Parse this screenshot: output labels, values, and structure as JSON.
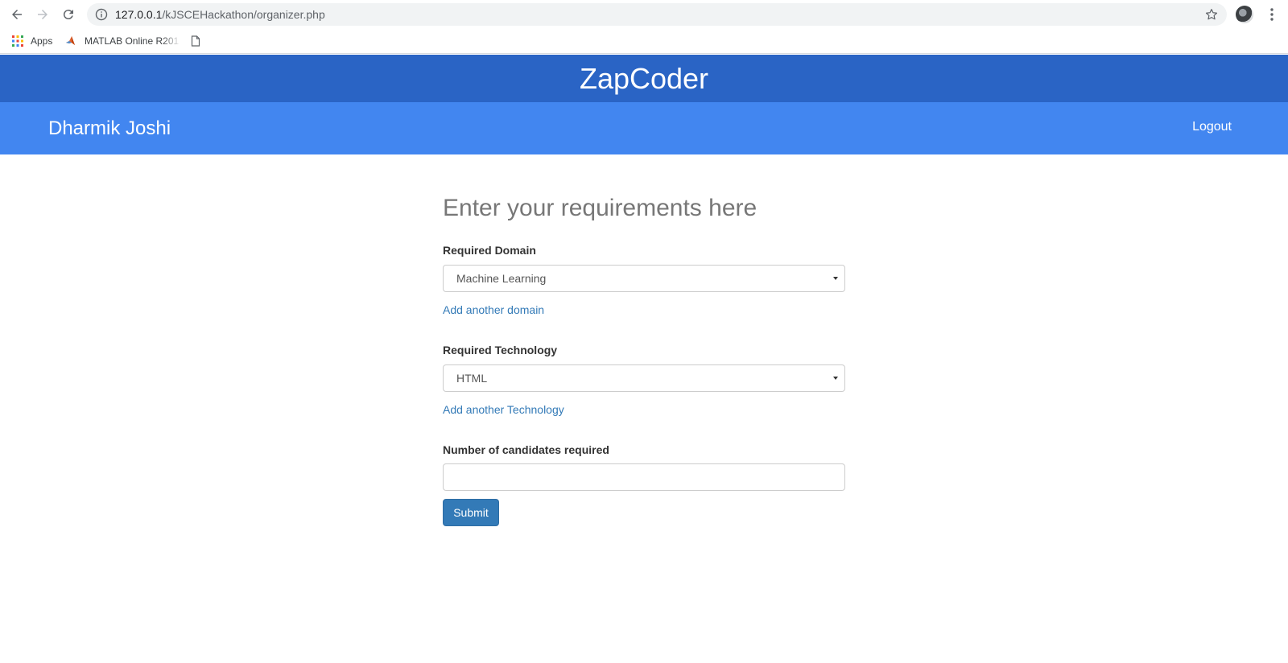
{
  "browser": {
    "url_host": "127.0.0.1",
    "url_path": "/kJSCEHackathon/organizer.php",
    "bookmarks": [
      {
        "label": "Apps",
        "icon": "apps-grid-icon"
      },
      {
        "label": "MATLAB Online R201",
        "icon": "matlab-icon"
      },
      {
        "label": "",
        "icon": "page-icon"
      }
    ]
  },
  "header": {
    "brand": "ZapCoder",
    "user_name": "Dharmik Joshi",
    "logout": "Logout"
  },
  "form": {
    "heading": "Enter your requirements here",
    "domain_label": "Required Domain",
    "domain_value": "Machine Learning",
    "add_domain": "Add another domain",
    "technology_label": "Required Technology",
    "technology_value": "HTML",
    "add_technology": "Add another Technology",
    "candidates_label": "Number of candidates required",
    "candidates_value": "",
    "submit": "Submit"
  },
  "colors": {
    "brand_bar": "#2a64c5",
    "user_bar": "#4286f0",
    "link": "#337ab7",
    "button": "#337ab7"
  }
}
